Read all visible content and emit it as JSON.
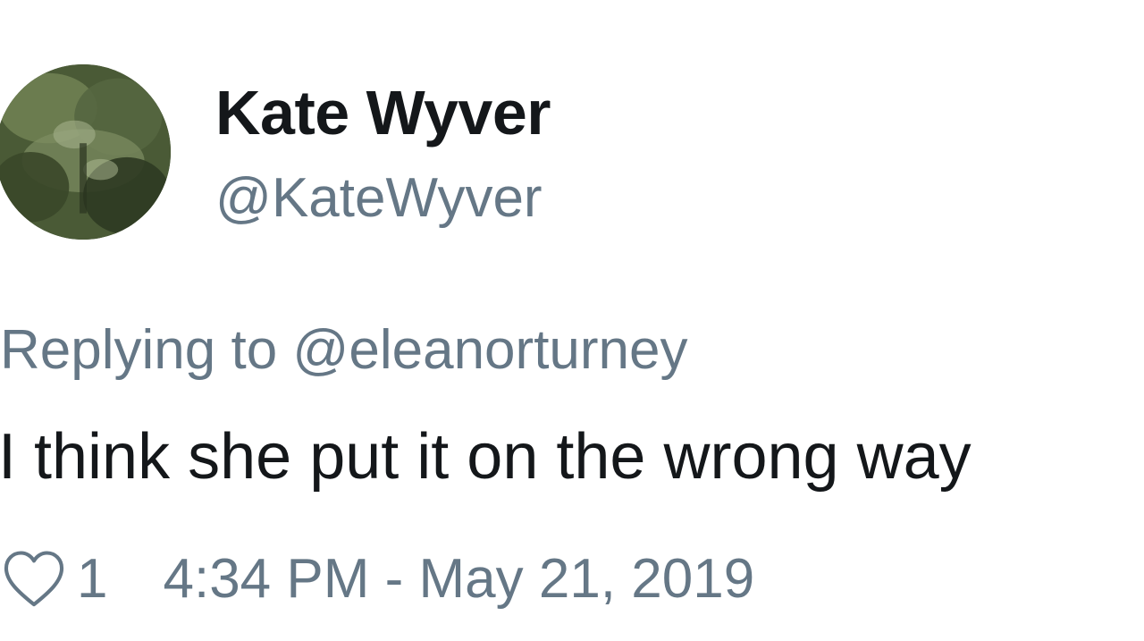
{
  "author": {
    "display_name": "Kate Wyver",
    "handle": "@KateWyver"
  },
  "reply": {
    "prefix": "Replying to",
    "to_handle": "@eleanorturney"
  },
  "tweet": {
    "text": "I think she put it on the wrong way"
  },
  "footer": {
    "like_icon": "heart-outline-icon",
    "like_count": "1",
    "timestamp": "4:34 PM - May 21, 2019"
  },
  "colors": {
    "primary_text": "#14171a",
    "secondary_text": "#657786",
    "background": "#ffffff"
  }
}
